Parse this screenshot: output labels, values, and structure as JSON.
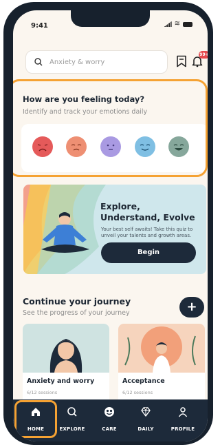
{
  "status_bar": {
    "time": "9:41"
  },
  "search": {
    "placeholder": "Anxiety & worry"
  },
  "notifications": {
    "badge": "99+"
  },
  "mood": {
    "title": "How are you feeling today?",
    "subtitle": "Identify and track your emotions daily",
    "faces": [
      {
        "name": "very-sad-face-icon",
        "color": "#e55a5a"
      },
      {
        "name": "sad-face-icon",
        "color": "#ee8f73"
      },
      {
        "name": "neutral-face-icon",
        "color": "#a99ae2"
      },
      {
        "name": "happy-face-icon",
        "color": "#7fbfe3"
      },
      {
        "name": "very-happy-face-icon",
        "color": "#86a79b"
      }
    ]
  },
  "banner": {
    "title_line1": "Explore,",
    "title_line2": "Understand, Evolve",
    "subtitle": "Your best self awaits! Take this quiz to unveil your talents and growth areas.",
    "button": "Begin"
  },
  "journey": {
    "title": "Continue your journey",
    "subtitle": "See the progress of your journey",
    "add_label": "+",
    "cards": [
      {
        "title": "Anxiety and worry",
        "sessions": "6/12 sessions",
        "progress": 0.5
      },
      {
        "title": "Acceptance",
        "sessions": "6/12 sessions",
        "progress": 0.5
      }
    ]
  },
  "nav": {
    "items": [
      {
        "label": "HOME",
        "icon": "home-icon",
        "active": true
      },
      {
        "label": "EXPLORE",
        "icon": "search-icon",
        "active": false
      },
      {
        "label": "CARE",
        "icon": "care-icon",
        "active": false
      },
      {
        "label": "DAILY",
        "icon": "diamond-icon",
        "active": false
      },
      {
        "label": "PROFILE",
        "icon": "profile-icon",
        "active": false
      }
    ]
  },
  "colors": {
    "accent_highlight": "#f5a233",
    "primary_dark": "#1d2a3a",
    "background": "#fbf6ef"
  }
}
